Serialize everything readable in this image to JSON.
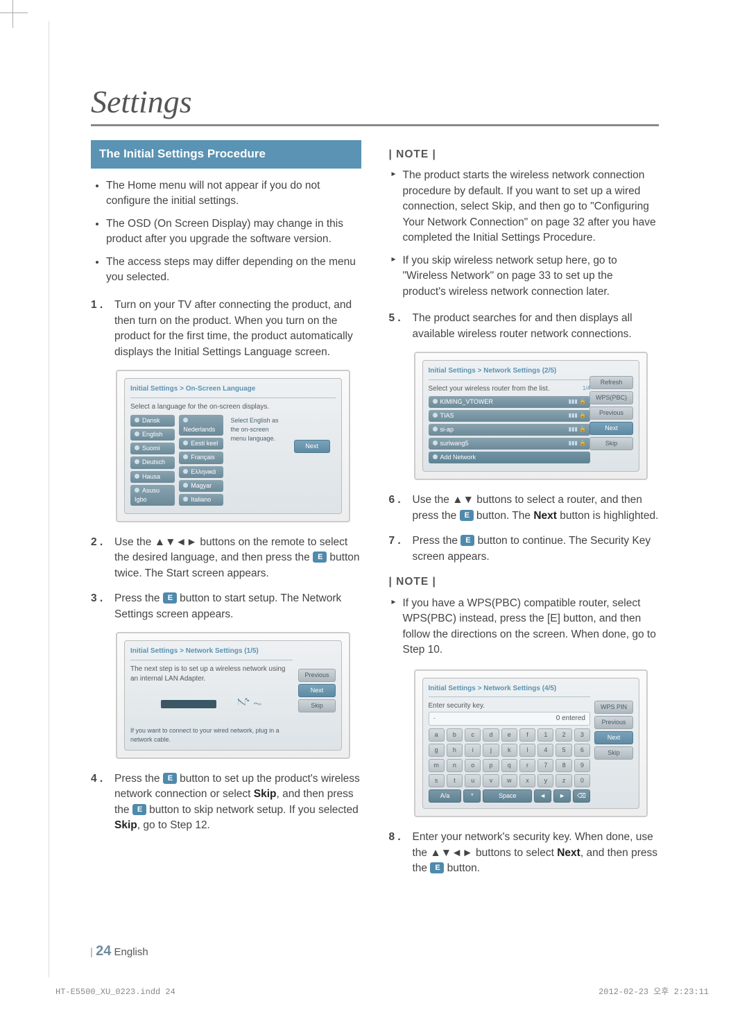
{
  "title": "Settings",
  "section_head": "The Initial Settings Procedure",
  "bullets": [
    "The Home menu will not appear if you do not configure the initial settings.",
    "The OSD (On Screen Display) may change in this product after you upgrade the software version.",
    "The access steps may differ depending on the menu you selected."
  ],
  "steps": {
    "s1_n": "1 .",
    "s1": "Turn on your TV after connecting the product, and then turn on the product. When you turn on the product for the first time, the product automatically displays the Initial Settings Language screen.",
    "s2_n": "2 .",
    "s2a": "Use the ",
    "s2_ar": "▲▼◄►",
    "s2b": " buttons on the remote to select the desired language, and then press the ",
    "s2c": " button twice. The Start screen appears.",
    "s3_n": "3 .",
    "s3a": "Press the ",
    "s3b": " button to start setup. The Network Settings screen appears.",
    "s4_n": "4 .",
    "s4a": "Press the ",
    "s4b": " button to set up the product's wireless network connection or select ",
    "s4_skip": "Skip",
    "s4c": ", and then press the ",
    "s4d": " button to skip network setup. If you selected ",
    "s4e": ", go to Step 12.",
    "s5_n": "5 .",
    "s5": "The product searches for and then displays all available wireless router network connections.",
    "s6_n": "6 .",
    "s6a": "Use the ",
    "s6_ar": "▲▼",
    "s6b": " buttons to select a router, and then press the ",
    "s6c": " button. The ",
    "s6_next": "Next",
    "s6d": " button is highlighted.",
    "s7_n": "7 .",
    "s7a": "Press the ",
    "s7b": " button to continue. The Security Key screen appears.",
    "s8_n": "8 .",
    "s8a": "Enter your network's security key. When done, use the ",
    "s8_ar": "▲▼◄►",
    "s8b": " buttons to select ",
    "s8_next": "Next",
    "s8c": ", and then press the ",
    "s8d": " button."
  },
  "note_label": "| NOTE |",
  "notes1": [
    "The product starts the wireless network connection procedure by default. If you want to set up a wired connection, select Skip, and then go to \"Configuring Your Network Connection\" on page 32 after you have completed the Initial Settings Procedure.",
    "If you skip wireless network setup here, go to \"Wireless Network\" on page 33 to set up the product's wireless network connection later."
  ],
  "notes2": [
    "If you have a WPS(PBC) compatible router, select WPS(PBC) instead, press the [E] button, and then follow the directions on the screen. When done, go to Step 10."
  ],
  "screen1": {
    "title": "Initial Settings > On-Screen Language",
    "prompt": "Select a language for the on-screen displays.",
    "col1": [
      "Dansk",
      "English",
      "Suomi",
      "Deutsch",
      "Hausa",
      "Asusu Igbo"
    ],
    "col2": [
      "Nederlands",
      "Eesti keel",
      "Français",
      "Ελληνικά",
      "Magyar",
      "Italiano"
    ],
    "hint": "Select English as the on-screen menu language.",
    "next": "Next"
  },
  "screen2": {
    "title": "Initial Settings > Network Settings (1/5)",
    "prompt": "The next step is to set up a wireless network using an internal LAN Adapter.",
    "hint": "If you want to connect to your wired network, plug in a network cable.",
    "prev": "Previous",
    "next": "Next",
    "skip": "Skip"
  },
  "screen3": {
    "title": "Initial Settings > Network Settings (2/5)",
    "prompt": "Select your wireless router from the list.",
    "pg": "1/4",
    "routers": [
      "KIMING_VTOWER",
      "TIAS",
      "si-ap",
      "surlwang5"
    ],
    "add": "Add Network",
    "refresh": "Refresh",
    "wps": "WPS(PBC)",
    "prev": "Previous",
    "next": "Next",
    "skip": "Skip"
  },
  "screen4": {
    "title": "Initial Settings > Network Settings (4/5)",
    "prompt": "Enter security key.",
    "entered": "0 entered",
    "keys": {
      "r1": [
        "a",
        "b",
        "c",
        "d",
        "e",
        "f",
        "1",
        "2",
        "3"
      ],
      "r2": [
        "g",
        "h",
        "i",
        "j",
        "k",
        "l",
        "4",
        "5",
        "6"
      ],
      "r3": [
        "m",
        "n",
        "o",
        "p",
        "q",
        "r",
        "7",
        "8",
        "9"
      ],
      "r4": [
        "s",
        "t",
        "u",
        "v",
        "w",
        "x",
        "y",
        "z",
        "0"
      ],
      "r5": [
        "A/a",
        "*",
        "Space",
        "◄",
        "►",
        "⌫"
      ]
    },
    "wpspin": "WPS PIN",
    "prev": "Previous",
    "next": "Next",
    "skip": "Skip"
  },
  "footer": {
    "bar": "|",
    "num": "24",
    "lang": "English"
  },
  "meta_left": "HT-E5500_XU_0223.indd   24",
  "meta_right": "2012-02-23   오후 2:23:11"
}
